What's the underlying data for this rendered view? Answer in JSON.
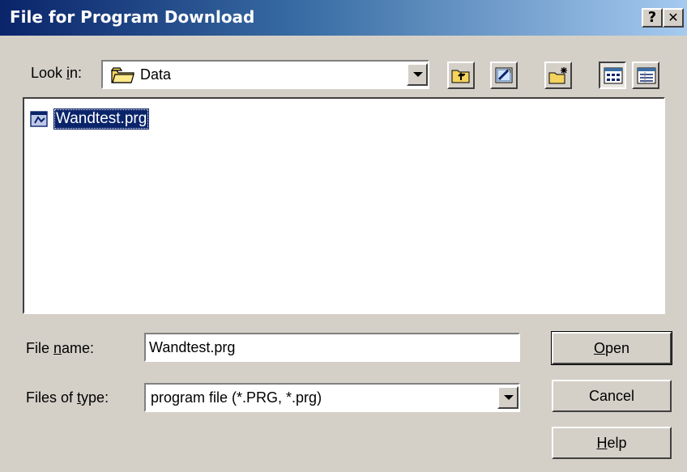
{
  "window": {
    "title": "File for Program Download",
    "help_btn": "?",
    "close_btn": "✕"
  },
  "look_in": {
    "label_pre": "Look ",
    "label_accel": "i",
    "label_post": "n:",
    "value": "Data",
    "folder_icon": "folder-icon"
  },
  "toolbar": {
    "icons": [
      "up-one-level-icon",
      "desktop-icon",
      "new-folder-icon",
      "list-view-icon",
      "details-view-icon"
    ]
  },
  "files": [
    {
      "name": "Wandtest.prg",
      "icon": "program-file-icon",
      "selected": true
    }
  ],
  "file_name": {
    "label_pre": "File ",
    "label_accel": "n",
    "label_post": "ame:",
    "value": "Wandtest.prg"
  },
  "file_type": {
    "label_pre": "Files of ",
    "label_accel": "t",
    "label_post": "ype:",
    "value": "program file (*.PRG, *.prg)"
  },
  "buttons": {
    "open_accel": "O",
    "open_rest": "pen",
    "cancel": "Cancel",
    "help_accel": "H",
    "help_rest": "elp"
  },
  "colors": {
    "titlebar_start": "#0a246a",
    "titlebar_end": "#a6caf0",
    "dialog_bg": "#d4d0c8",
    "selection": "#0a246a"
  }
}
